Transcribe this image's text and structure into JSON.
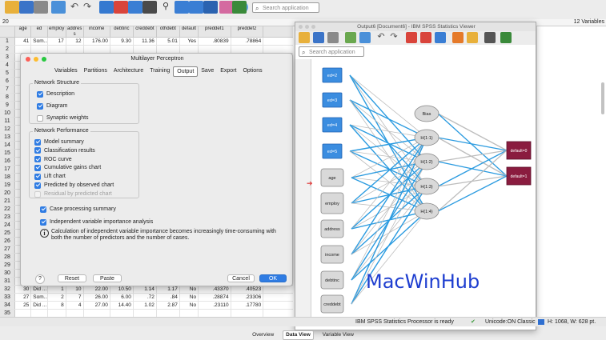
{
  "toolbar": {
    "search_placeholder": "Search application"
  },
  "data_editor": {
    "cell_ref": "20",
    "variable_count": "12 Variables",
    "columns": [
      "age",
      "ed",
      "employ",
      "address",
      "income",
      "debtinc",
      "creddebt",
      "othdebt",
      "default",
      "preddef1",
      "preddef2"
    ],
    "rows": [
      {
        "n": "1",
        "cells": [
          "41",
          "Som...",
          "17",
          "12",
          "176.00",
          "9.30",
          "11.36",
          "5.01",
          "Yes",
          ".80839",
          ".78864"
        ]
      },
      {
        "n": "2",
        "cells": [
          "",
          "",
          "",
          "",
          "",
          "",
          "",
          "",
          "",
          "",
          ""
        ]
      },
      {
        "n": "3",
        "cells": [
          "",
          "",
          "",
          "",
          "",
          "",
          "",
          "",
          "",
          "",
          ""
        ]
      },
      {
        "n": "4",
        "cells": [
          "",
          "",
          "",
          "",
          "",
          "",
          "",
          "",
          "",
          "",
          ""
        ]
      },
      {
        "n": "5",
        "cells": [
          "",
          "",
          "",
          "",
          "",
          "",
          "",
          "",
          "",
          "",
          ""
        ]
      },
      {
        "n": "6",
        "cells": [
          "",
          "",
          "",
          "",
          "",
          "",
          "",
          "",
          "",
          "",
          ""
        ]
      },
      {
        "n": "7",
        "cells": [
          "",
          "",
          "",
          "",
          "",
          "",
          "",
          "",
          "",
          "",
          ""
        ]
      },
      {
        "n": "8",
        "cells": [
          "",
          "",
          "",
          "",
          "",
          "",
          "",
          "",
          "",
          "",
          ""
        ]
      },
      {
        "n": "9",
        "cells": [
          "",
          "",
          "",
          "",
          "",
          "",
          "",
          "",
          "",
          "",
          ""
        ]
      },
      {
        "n": "10",
        "cells": [
          "",
          "",
          "",
          "",
          "",
          "",
          "",
          "",
          "",
          "",
          ""
        ]
      },
      {
        "n": "11",
        "cells": [
          "",
          "",
          "",
          "",
          "",
          "",
          "",
          "",
          "",
          "",
          ""
        ]
      },
      {
        "n": "12",
        "cells": [
          "",
          "",
          "",
          "",
          "",
          "",
          "",
          "",
          "",
          "",
          ""
        ]
      },
      {
        "n": "13",
        "cells": [
          "",
          "",
          "",
          "",
          "",
          "",
          "",
          "",
          "",
          "",
          ""
        ]
      },
      {
        "n": "14",
        "cells": [
          "",
          "",
          "",
          "",
          "",
          "",
          "",
          "",
          "",
          "",
          ""
        ]
      },
      {
        "n": "15",
        "cells": [
          "",
          "",
          "",
          "",
          "",
          "",
          "",
          "",
          "",
          "",
          ""
        ]
      },
      {
        "n": "16",
        "cells": [
          "",
          "",
          "",
          "",
          "",
          "",
          "",
          "",
          "",
          "",
          ""
        ]
      },
      {
        "n": "17",
        "cells": [
          "",
          "",
          "",
          "",
          "",
          "",
          "",
          "",
          "",
          "",
          ""
        ]
      },
      {
        "n": "18",
        "cells": [
          "",
          "",
          "",
          "",
          "",
          "",
          "",
          "",
          "",
          "",
          ""
        ]
      },
      {
        "n": "19",
        "cells": [
          "",
          "",
          "",
          "",
          "",
          "",
          "",
          "",
          "",
          "",
          ""
        ]
      },
      {
        "n": "20",
        "cells": [
          "",
          "",
          "",
          "",
          "",
          "",
          "",
          "",
          "",
          "",
          ""
        ]
      },
      {
        "n": "21",
        "cells": [
          "",
          "",
          "",
          "",
          "",
          "",
          "",
          "",
          "",
          "",
          ""
        ]
      },
      {
        "n": "22",
        "cells": [
          "",
          "",
          "",
          "",
          "",
          "",
          "",
          "",
          "",
          "",
          ""
        ]
      },
      {
        "n": "23",
        "cells": [
          "",
          "",
          "",
          "",
          "",
          "",
          "",
          "",
          "",
          "",
          ""
        ]
      },
      {
        "n": "24",
        "cells": [
          "",
          "",
          "",
          "",
          "",
          "",
          "",
          "",
          "",
          "",
          ""
        ]
      },
      {
        "n": "25",
        "cells": [
          "",
          "",
          "",
          "",
          "",
          "",
          "",
          "",
          "",
          "",
          ""
        ]
      },
      {
        "n": "26",
        "cells": [
          "",
          "",
          "",
          "",
          "",
          "",
          "",
          "",
          "",
          "",
          ""
        ]
      },
      {
        "n": "27",
        "cells": [
          "",
          "",
          "",
          "",
          "",
          "",
          "",
          "",
          "",
          "",
          ""
        ]
      },
      {
        "n": "28",
        "cells": [
          "",
          "",
          "",
          "",
          "",
          "",
          "",
          "",
          "",
          "",
          ""
        ]
      },
      {
        "n": "29",
        "cells": [
          "",
          "",
          "",
          "",
          "",
          "",
          "",
          "",
          "",
          "",
          ""
        ]
      },
      {
        "n": "30",
        "cells": [
          "",
          "",
          "",
          "",
          "",
          "",
          "",
          "",
          "",
          "",
          ""
        ]
      },
      {
        "n": "31",
        "cells": [
          "47",
          "Did ...",
          "",
          "",
          "",
          "",
          "",
          "",
          "",
          "",
          ""
        ]
      },
      {
        "n": "32",
        "cells": [
          "30",
          "Did ...",
          "1",
          "10",
          "22.00",
          "10.50",
          "1.14",
          "1.17",
          "No",
          ".43370",
          ".40523"
        ]
      },
      {
        "n": "33",
        "cells": [
          "27",
          "Som...",
          "2",
          "7",
          "26.00",
          "6.00",
          ".72",
          ".84",
          "No",
          ".28874",
          ".23306"
        ]
      },
      {
        "n": "34",
        "cells": [
          "25",
          "Did ...",
          "8",
          "4",
          "27.00",
          "14.40",
          "1.02",
          "2.87",
          "No",
          ".23110",
          ".17780"
        ]
      },
      {
        "n": "35",
        "cells": [
          "",
          "",
          "",
          "",
          "",
          "",
          "",
          "",
          "",
          "",
          ""
        ]
      }
    ]
  },
  "dialog": {
    "title": "Multilayer Perceptron",
    "tabs": [
      "Variables",
      "Partitions",
      "Architecture",
      "Training",
      "Output",
      "Save",
      "Export",
      "Options"
    ],
    "active_tab": "Output",
    "network_structure": {
      "legend": "Network Structure",
      "description": "Description",
      "diagram": "Diagram",
      "synaptic": "Synaptic weights"
    },
    "network_performance": {
      "legend": "Network Performance",
      "items": [
        "Model summary",
        "Classification results",
        "ROC curve",
        "Cumulative gains chart",
        "Lift chart",
        "Predicted by observed chart"
      ],
      "residual": "Residual by predicted chart"
    },
    "case_processing": "Case processing summary",
    "independent_importance": "Independent variable importance analysis",
    "info_text": "Calculation of independent variable importance becomes increasingly time-consuming with both the number of predictors and the number of cases.",
    "help": "?",
    "reset": "Reset",
    "paste": "Paste",
    "cancel": "Cancel",
    "ok": "OK"
  },
  "viewer": {
    "title": "Output6 [Document6] - IBM SPSS Statistics Viewer",
    "search_placeholder": "Search application",
    "input_nodes": [
      "ed=2",
      "ed=3",
      "ed=4",
      "ed=5",
      "age",
      "employ",
      "address",
      "income",
      "debtinc",
      "creddebt"
    ],
    "hidden_nodes": [
      "Bias",
      "H(1:1)",
      "H(1:2)",
      "H(1:3)",
      "H(1:4)"
    ],
    "output_nodes": [
      "default=0",
      "default=1"
    ],
    "watermark": "MacWinHub"
  },
  "status_bar": {
    "processor": "IBM SPSS Statistics Processor is ready",
    "encoding": "Unicode:ON Classic",
    "size": "H: 1068, W: 628 pt."
  },
  "bottom_tabs": [
    "Overview",
    "Data View",
    "Variable View"
  ],
  "bottom_active": "Data View"
}
